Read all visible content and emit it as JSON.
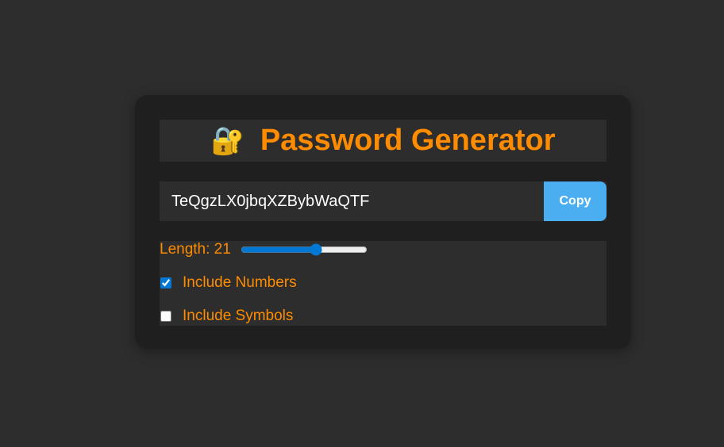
{
  "header": {
    "icon": "🔐",
    "title": "Password Generator"
  },
  "password": {
    "value": "TeQgzLX0jbqXZBybWaQTF",
    "copy_label": "Copy"
  },
  "options": {
    "length_label": "Length: 21",
    "length": {
      "value": 21,
      "min": 4,
      "max": 32
    },
    "numbers": {
      "label": "Include Numbers",
      "checked": true
    },
    "symbols": {
      "label": "Include Symbols",
      "checked": false
    }
  },
  "colors": {
    "accent": "#ff8c00",
    "button": "#4aaef0",
    "card": "#1f1f1f",
    "background": "#2d2d2d"
  }
}
